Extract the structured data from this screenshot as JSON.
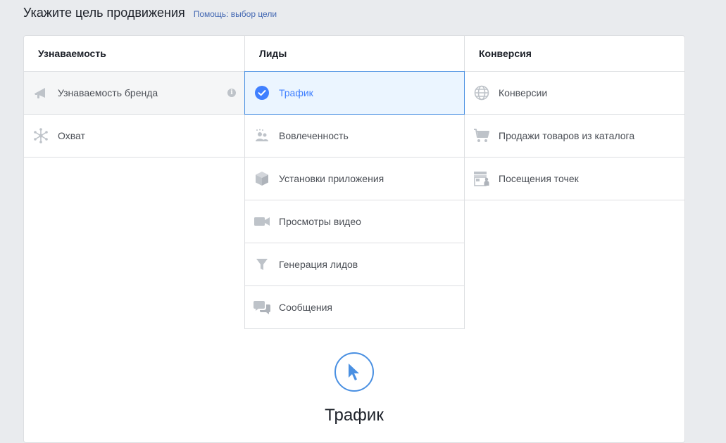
{
  "header": {
    "title": "Укажите цель продвижения",
    "help_link": "Помощь: выбор цели"
  },
  "columns": [
    {
      "title": "Узнаваемость",
      "items": [
        {
          "label": "Узнаваемость бренда",
          "icon": "megaphone-icon"
        },
        {
          "label": "Охват",
          "icon": "reach-icon"
        }
      ]
    },
    {
      "title": "Лиды",
      "items": [
        {
          "label": "Трафик",
          "icon": "check-circle-icon",
          "selected": true
        },
        {
          "label": "Вовлеченность",
          "icon": "people-icon"
        },
        {
          "label": "Установки приложения",
          "icon": "box-icon"
        },
        {
          "label": "Просмотры видео",
          "icon": "video-camera-icon"
        },
        {
          "label": "Генерация лидов",
          "icon": "funnel-icon"
        },
        {
          "label": "Сообщения",
          "icon": "chat-bubbles-icon"
        }
      ]
    },
    {
      "title": "Конверсия",
      "items": [
        {
          "label": "Конверсии",
          "icon": "globe-icon"
        },
        {
          "label": "Продажи товаров из каталога",
          "icon": "cart-icon"
        },
        {
          "label": "Посещения точек",
          "icon": "store-icon"
        }
      ]
    }
  ],
  "selected_objective": {
    "title": "Трафик",
    "icon": "cursor-icon"
  },
  "colors": {
    "accent": "#4080ff",
    "icon_gray": "#bec3c9",
    "selected_bg": "#ebf5ff",
    "selected_border": "#4a90e2"
  }
}
